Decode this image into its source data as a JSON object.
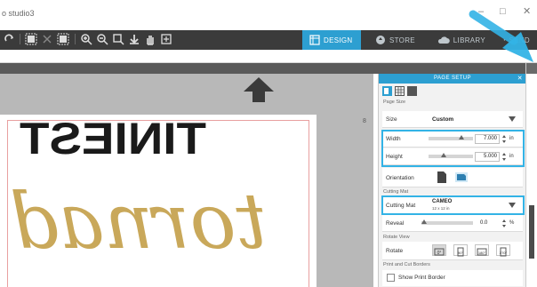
{
  "window": {
    "app_title": "o studio3",
    "minimize": "–",
    "maximize": "□",
    "close": "✕"
  },
  "toolbar": {
    "tabs": [
      {
        "label": "DESIGN",
        "icon": "design-icon",
        "active": true
      },
      {
        "label": "STORE",
        "icon": "store-icon",
        "active": false
      },
      {
        "label": "LIBRARY",
        "icon": "cloud-icon",
        "active": false
      },
      {
        "label": "SEND",
        "icon": "send-icon",
        "active": false
      }
    ]
  },
  "canvas": {
    "ruler_mark": "8",
    "design_text_line1": "TINIEST",
    "design_text_line2": "tornad",
    "text_color": "#1a1a1a",
    "script_color": "#c9a85a"
  },
  "page_setup": {
    "title": "PAGE SETUP",
    "close": "✕",
    "section_page_size": "Page Size",
    "size": {
      "label": "Size",
      "value": "Custom"
    },
    "width": {
      "label": "Width",
      "value": "7.000",
      "unit": "in"
    },
    "height": {
      "label": "Height",
      "value": "5.000",
      "unit": "in"
    },
    "orientation": {
      "label": "Orientation"
    },
    "section_cutting_mat": "Cutting Mat",
    "cutting_mat": {
      "label": "Cutting Mat",
      "value": "CAMEO",
      "subvalue": "12 x 12 in"
    },
    "reveal": {
      "label": "Reveal",
      "value": "0.0",
      "unit": "%"
    },
    "section_rotate_view": "Rotate View",
    "rotate": {
      "label": "Rotate",
      "buttons": [
        "0°",
        "90°",
        "180°",
        "270°"
      ]
    },
    "section_print_cut": "Print and Cut Borders",
    "show_print_border": {
      "label": "Show Print Border",
      "checked": false
    }
  },
  "colors": {
    "accent": "#2d9fd1",
    "highlight": "#33b3e6",
    "toolbar_bg": "#3b3b3b"
  }
}
